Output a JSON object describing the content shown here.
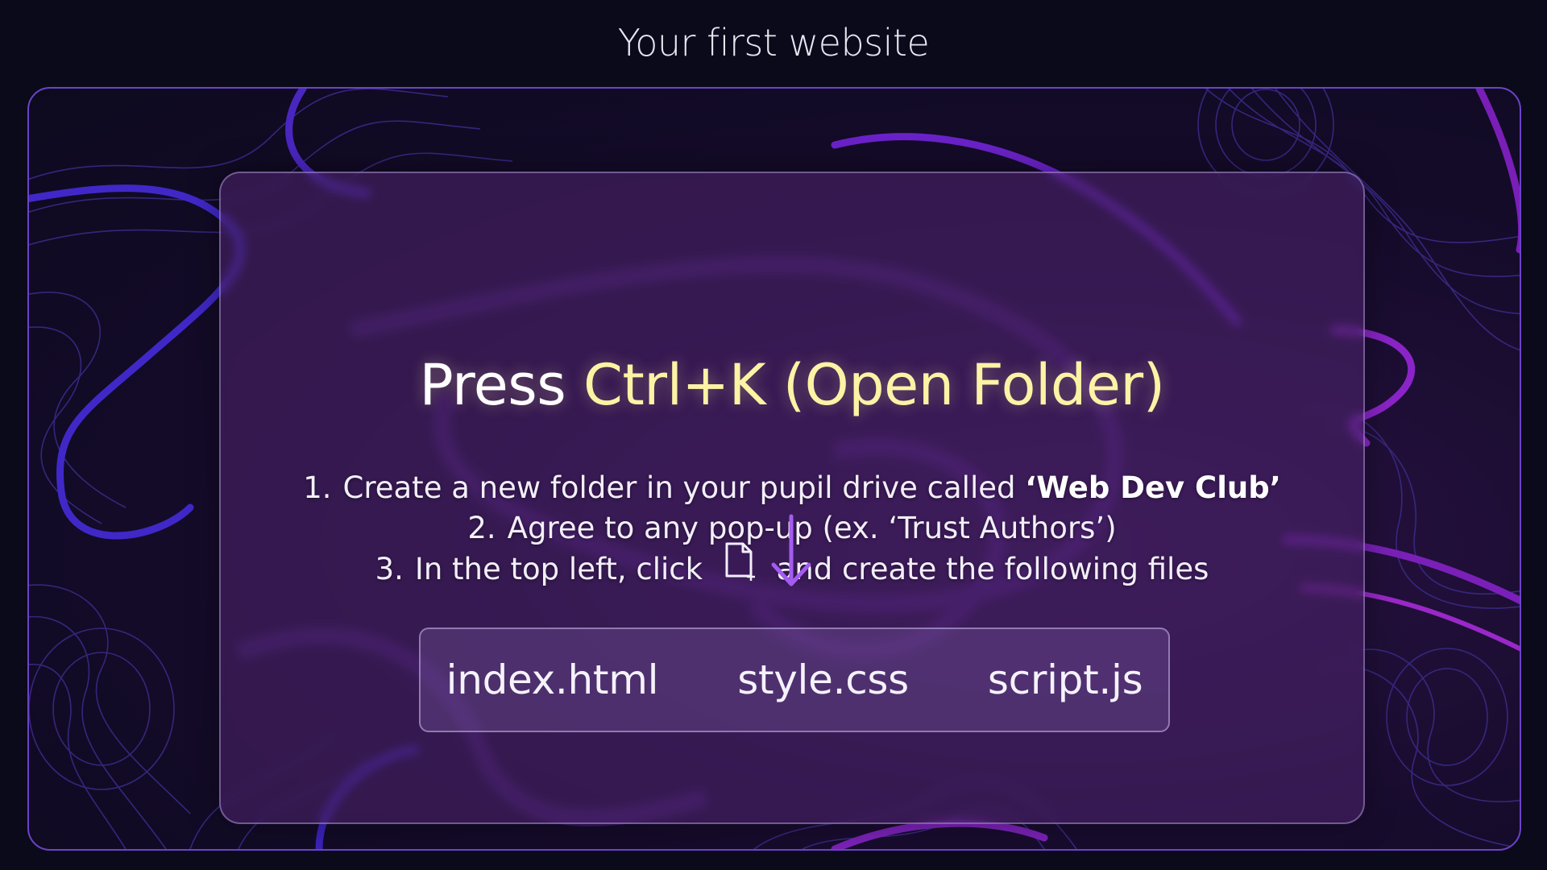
{
  "page": {
    "title": "Your first website"
  },
  "card": {
    "headline_prefix": "Press ",
    "headline_accent": "Ctrl+K (Open Folder)",
    "steps": [
      {
        "number": "1.",
        "text": "Create a new folder in your pupil drive called ",
        "bold": "‘Web Dev Club’"
      },
      {
        "number": "2.",
        "text": "Agree to any pop-up (ex. ‘Trust Authors’)"
      },
      {
        "number": "3.",
        "text_before_icon": "In the top left, click",
        "icon": "new-file-icon",
        "text_after_icon": "and create the following files"
      }
    ],
    "arrow_icon": "arrow-down-icon",
    "files": [
      "index.html",
      "style.css",
      "script.js"
    ]
  },
  "colors": {
    "background": "#0b0a1a",
    "stage_border": "#6b43c9",
    "accent_yellow": "#fdf3a5",
    "arrow_purple": "#a45cf0",
    "topo_line": "#3d2a8a",
    "topo_bold_blue": "#3f2bd0",
    "topo_bold_purple": "#8a24c8"
  }
}
